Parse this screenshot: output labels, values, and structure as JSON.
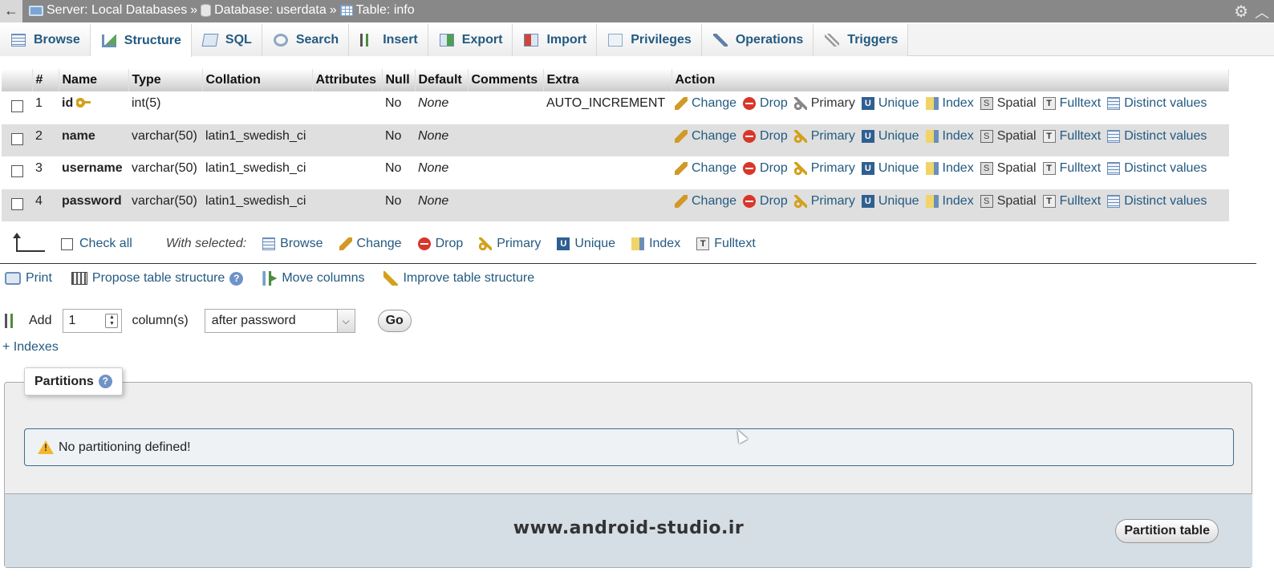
{
  "breadcrumb": {
    "server": "Server: Local Databases",
    "database": "Database: userdata",
    "table": "Table: info",
    "sep": "»"
  },
  "tabs": [
    {
      "label": "Browse",
      "icon": "browse-icon"
    },
    {
      "label": "Structure",
      "icon": "structure-icon"
    },
    {
      "label": "SQL",
      "icon": "sql-icon"
    },
    {
      "label": "Search",
      "icon": "search-icon"
    },
    {
      "label": "Insert",
      "icon": "insert-icon"
    },
    {
      "label": "Export",
      "icon": "export-icon"
    },
    {
      "label": "Import",
      "icon": "import-icon"
    },
    {
      "label": "Privileges",
      "icon": "privileges-icon"
    },
    {
      "label": "Operations",
      "icon": "operations-icon"
    },
    {
      "label": "Triggers",
      "icon": "triggers-icon"
    }
  ],
  "table": {
    "headers": [
      "#",
      "Name",
      "Type",
      "Collation",
      "Attributes",
      "Null",
      "Default",
      "Comments",
      "Extra",
      "Action"
    ],
    "rows": [
      {
        "num": "1",
        "name": "id",
        "type": "int(5)",
        "collation": "",
        "attributes": "",
        "null": "No",
        "default": "None",
        "comments": "",
        "extra": "AUTO_INCREMENT"
      },
      {
        "num": "2",
        "name": "name",
        "type": "varchar(50)",
        "collation": "latin1_swedish_ci",
        "attributes": "",
        "null": "No",
        "default": "None",
        "comments": "",
        "extra": ""
      },
      {
        "num": "3",
        "name": "username",
        "type": "varchar(50)",
        "collation": "latin1_swedish_ci",
        "attributes": "",
        "null": "No",
        "default": "None",
        "comments": "",
        "extra": ""
      },
      {
        "num": "4",
        "name": "password",
        "type": "varchar(50)",
        "collation": "latin1_swedish_ci",
        "attributes": "",
        "null": "No",
        "default": "None",
        "comments": "",
        "extra": ""
      }
    ],
    "actions": {
      "change": "Change",
      "drop": "Drop",
      "primary": "Primary",
      "unique": "Unique",
      "index": "Index",
      "spatial": "Spatial",
      "fulltext": "Fulltext",
      "distinct": "Distinct values"
    }
  },
  "with_selected": {
    "check_all": "Check all",
    "label": "With selected:",
    "browse": "Browse",
    "change": "Change",
    "drop": "Drop",
    "primary": "Primary",
    "unique": "Unique",
    "index": "Index",
    "fulltext": "Fulltext"
  },
  "tools": {
    "print": "Print",
    "propose": "Propose table structure",
    "move": "Move columns",
    "improve": "Improve table structure"
  },
  "add_column": {
    "add_label": "Add",
    "count": "1",
    "columns_label": "column(s)",
    "position": "after password",
    "go": "Go"
  },
  "indexes_link": "+ Indexes",
  "partitions": {
    "legend": "Partitions",
    "notice": "No partitioning defined!",
    "button": "Partition table",
    "watermark": "www.android-studio.ir"
  }
}
